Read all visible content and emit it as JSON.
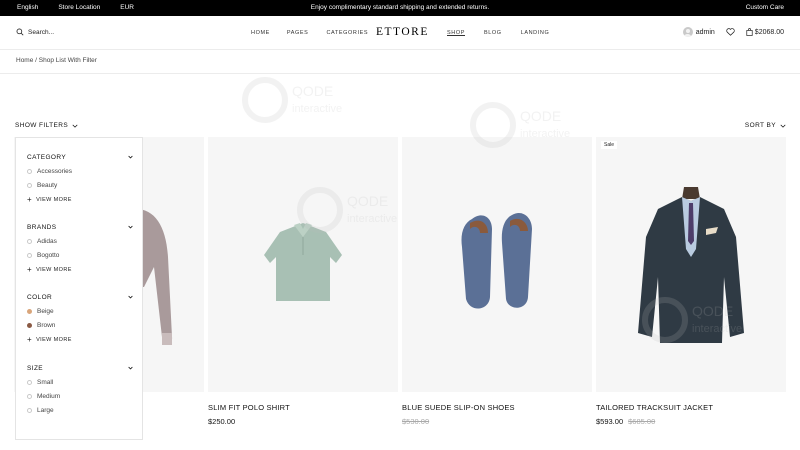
{
  "topbar": {
    "language": "English",
    "store_location": "Store Location",
    "currency": "EUR",
    "announcement": "Enjoy complimentary standard shipping and extended returns.",
    "customer_care": "Custom Care"
  },
  "header": {
    "search_label": "Search...",
    "nav": [
      "HOME",
      "PAGES",
      "CATEGORIES",
      "SHOP",
      "BLOG",
      "LANDING"
    ],
    "logo": "ETTORE",
    "user": "admin",
    "cart_total": "$2068.00"
  },
  "breadcrumb": {
    "home": "Home",
    "separator": "/",
    "current": "Shop List With Filter"
  },
  "toolbar": {
    "show_filters": "SHOW FILTERS",
    "sort_by": "SORT BY"
  },
  "filters": {
    "category": {
      "title": "CATEGORY",
      "options": [
        "Accessories",
        "Beauty"
      ],
      "view_more": "VIEW MORE"
    },
    "brands": {
      "title": "BRANDS",
      "options": [
        "Adidas",
        "Bogotto"
      ],
      "view_more": "VIEW MORE"
    },
    "color": {
      "title": "COLOR",
      "options": [
        {
          "label": "Beige",
          "color": "#d9a57a"
        },
        {
          "label": "Brown",
          "color": "#8a5a44"
        }
      ],
      "view_more": "VIEW MORE"
    },
    "size": {
      "title": "SIZE",
      "options": [
        "Small",
        "Medium",
        "Large"
      ]
    }
  },
  "products": [
    {
      "name": "",
      "price": "",
      "old_price": "",
      "badge": ""
    },
    {
      "name": "SLIM FIT POLO SHIRT",
      "price": "$250.00",
      "old_price": "",
      "badge": ""
    },
    {
      "name": "BLUE SUEDE SLIP-ON SHOES",
      "price": "",
      "old_price": "$530.00",
      "badge": ""
    },
    {
      "name": "TAILORED TRACKSUIT JACKET",
      "price": "$593.00",
      "old_price": "$685.00",
      "badge": "Sale"
    }
  ],
  "watermark": {
    "text_1": "QODE",
    "text_2": "interactive"
  },
  "colors": {
    "topbar_bg": "#000000",
    "card_bg": "#f6f6f6",
    "border": "#e4e4e4"
  }
}
